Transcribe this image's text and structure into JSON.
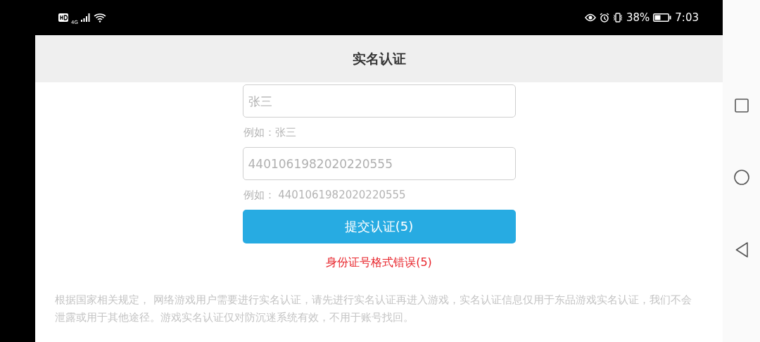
{
  "status_bar": {
    "network": "4G",
    "battery_percent": "38%",
    "time": "7:03"
  },
  "header": {
    "title": "实名认证"
  },
  "form": {
    "fields": [
      {
        "placeholder": "张三",
        "hint": "例如：张三"
      },
      {
        "placeholder": "4401061982020220555",
        "hint": "例如： 4401061982020220555"
      }
    ],
    "submit_button": "提交认证(5)",
    "error": "身份证号格式错误(5)"
  },
  "notice": "根据国家相关规定， 网络游戏用户需要进行实名认证，请先进行实名认证再进入游戏，实名认证信息仅用于东品游戏实名认证，我们不会泄露或用于其他途径。游戏实名认证仅对防沉迷系统有效，不用于账号找回。"
}
